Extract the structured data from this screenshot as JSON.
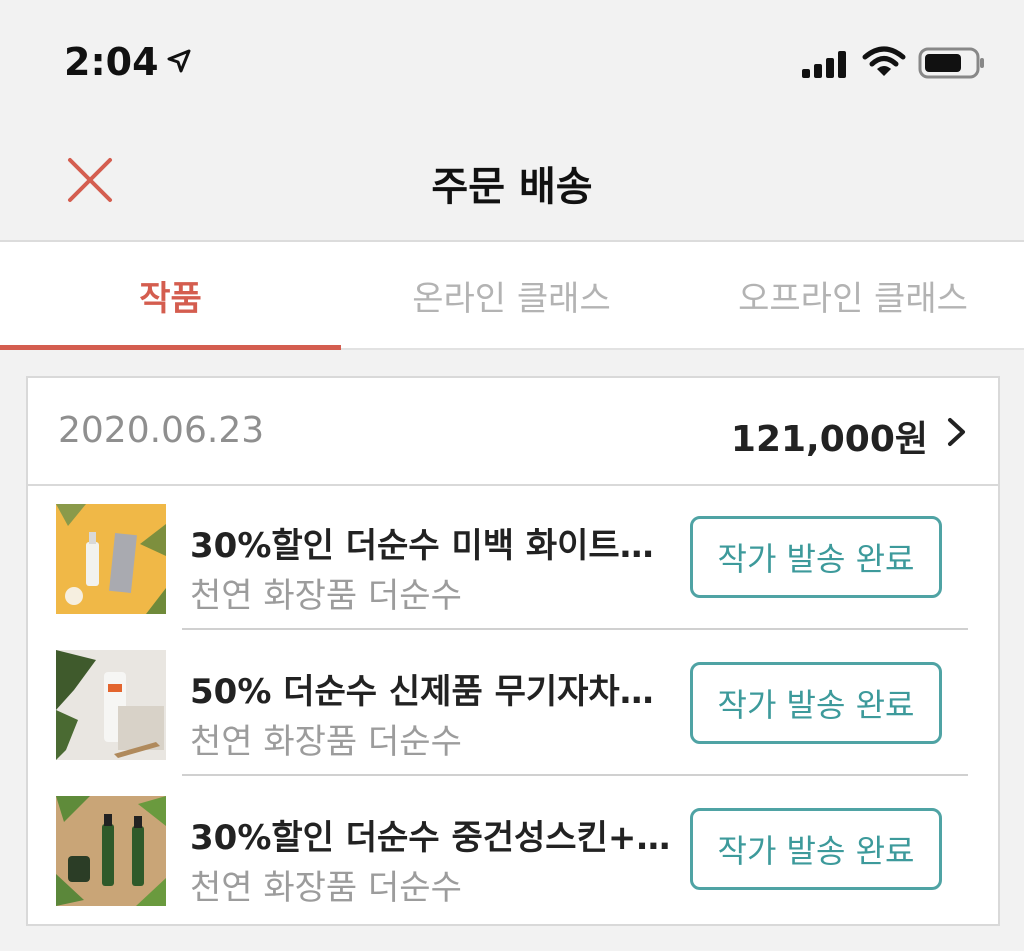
{
  "status_bar": {
    "time": "2:04"
  },
  "nav": {
    "title": "주문 배송"
  },
  "tabs": [
    {
      "label": "작품",
      "active": true
    },
    {
      "label": "온라인 클래스",
      "active": false
    },
    {
      "label": "오프라인 클래스",
      "active": false
    }
  ],
  "order": {
    "date": "2020.06.23",
    "total": "121,000원",
    "items": [
      {
        "title": "30%할인 더순수 미백 화이트…",
        "shop": "천연 화장품 더순수",
        "status": "작가 발송 완료"
      },
      {
        "title": "50% 더순수 신제품 무기자차…",
        "shop": "천연 화장품 더순수",
        "status": "작가 발송 완료"
      },
      {
        "title": "30%할인 더순수 중건성스킨+…",
        "shop": "천연 화장품 더순수",
        "status": "작가 발송 완료"
      }
    ]
  },
  "colors": {
    "accent": "#d45d4f",
    "teal": "#4fa3a4",
    "background": "#f2f2f2"
  }
}
